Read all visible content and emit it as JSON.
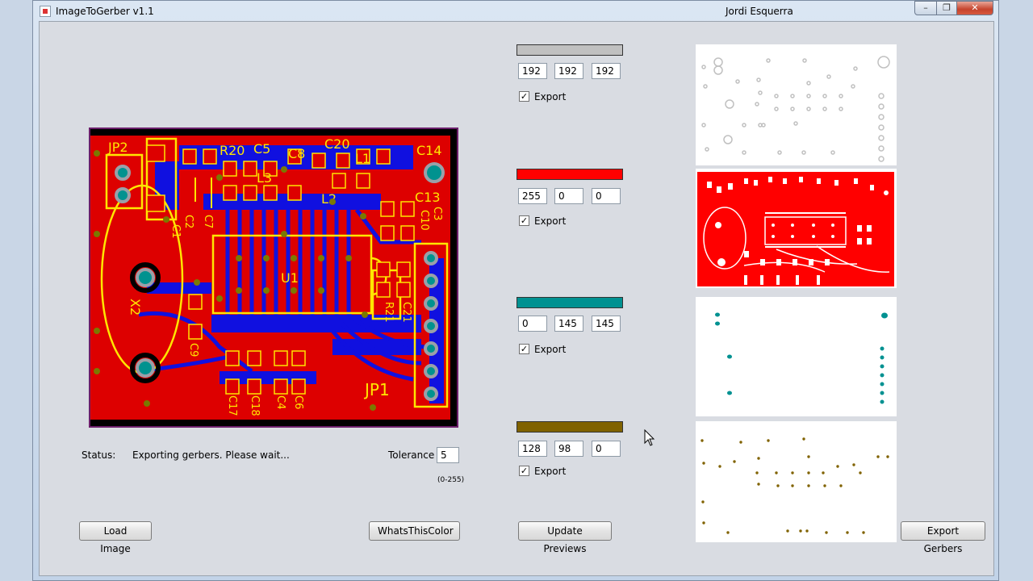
{
  "window": {
    "title": "ImageToGerber v1.1",
    "author": "Jordi Esquerra",
    "min_glyph": "–",
    "max_glyph": "❐",
    "close_glyph": "✕"
  },
  "pcb_labels": [
    "JP2",
    "R20",
    "C5",
    "C8",
    "C20",
    "L1",
    "C14",
    "C2",
    "C7",
    "L3",
    "L2",
    "C13",
    "C3",
    "C10",
    "C1",
    "U1",
    "X2",
    "C9",
    "R21",
    "C21",
    "JP1",
    "C17",
    "C18",
    "C4",
    "C6"
  ],
  "status": {
    "label": "Status:",
    "text": "Exporting gerbers. Please wait...",
    "tolerance_label": "Tolerance",
    "tolerance_value": "5",
    "tolerance_range": "(0-255)"
  },
  "buttons": {
    "load_image": "Load Image",
    "whats_this_color": "WhatsThisColor",
    "update_previews": "Update Previews",
    "export_gerbers": "Export Gerbers"
  },
  "layers": [
    {
      "color": "#c0c0c0",
      "r": "192",
      "g": "192",
      "b": "192",
      "export_label": "Export",
      "export_checked": true
    },
    {
      "color": "#ff0000",
      "r": "255",
      "g": "0",
      "b": "0",
      "export_label": "Export",
      "export_checked": true
    },
    {
      "color": "#009191",
      "r": "0",
      "g": "145",
      "b": "145",
      "export_label": "Export",
      "export_checked": true
    },
    {
      "color": "#806200",
      "r": "128",
      "g": "98",
      "b": "0",
      "export_label": "Export",
      "export_checked": true
    }
  ],
  "check_glyph": "✓"
}
